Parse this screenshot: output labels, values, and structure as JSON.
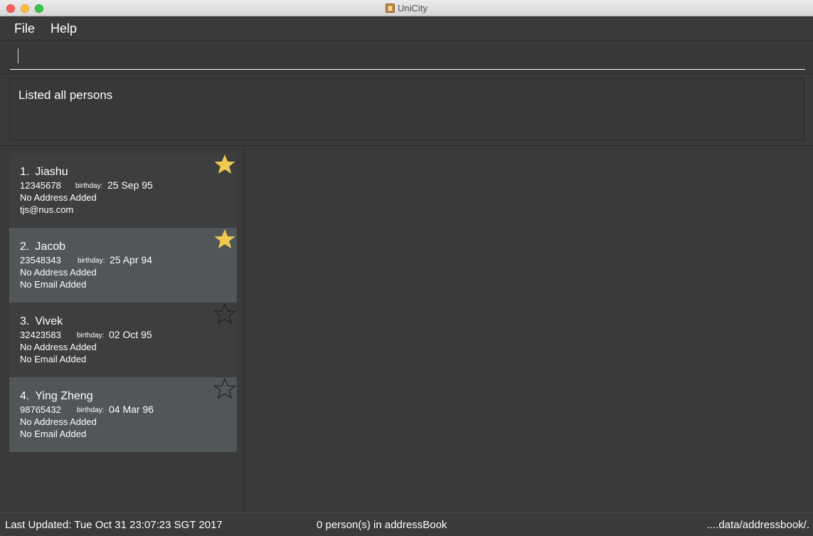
{
  "window": {
    "title": "UniCity"
  },
  "menu": {
    "file": "File",
    "help": "Help"
  },
  "command": {
    "value": "",
    "placeholder": ""
  },
  "result": {
    "message": "Listed all persons"
  },
  "persons": [
    {
      "index": "1.",
      "name": "Jiashu",
      "phone": "12345678",
      "birthday_label": "birthday:",
      "birthday": "25 Sep 95",
      "address": "No Address Added",
      "email": "tjs@nus.com",
      "favourite": true
    },
    {
      "index": "2.",
      "name": "Jacob",
      "phone": "23548343",
      "birthday_label": "birthday:",
      "birthday": "25 Apr 94",
      "address": "No Address Added",
      "email": "No Email Added",
      "favourite": true
    },
    {
      "index": "3.",
      "name": "Vivek",
      "phone": "32423583",
      "birthday_label": "birthday:",
      "birthday": "02 Oct 95",
      "address": "No Address Added",
      "email": "No Email Added",
      "favourite": false
    },
    {
      "index": "4.",
      "name": "Ying Zheng",
      "phone": "98765432",
      "birthday_label": "birthday:",
      "birthday": "04 Mar 96",
      "address": "No Address Added",
      "email": "No Email Added",
      "favourite": false
    }
  ],
  "status": {
    "last_updated": "Last Updated: Tue Oct 31 23:07:23 SGT 2017",
    "count": "0 person(s) in addressBook",
    "path": "....data/addressbook/."
  },
  "colors": {
    "star_filled": "#f0c94e",
    "star_empty": "#222222",
    "card_dark": "#3c3e3f",
    "card_light": "#515658"
  }
}
